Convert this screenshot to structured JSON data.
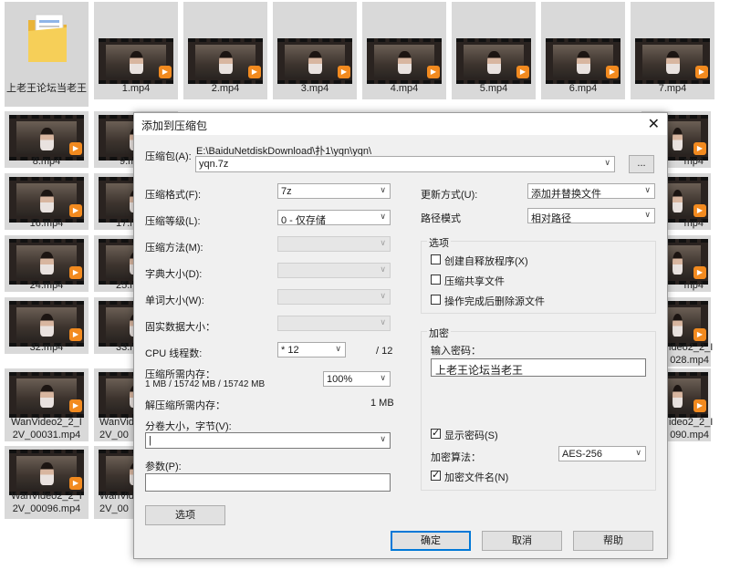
{
  "explorer": {
    "folder_name": "上老王论坛当老王",
    "tiles": [
      {
        "name": "1.mp4"
      },
      {
        "name": "2.mp4"
      },
      {
        "name": "3.mp4"
      },
      {
        "name": "4.mp4"
      },
      {
        "name": "5.mp4"
      },
      {
        "name": "6.mp4"
      },
      {
        "name": "7.mp4"
      },
      {
        "name": "8.mp4"
      },
      {
        "name": "9.m"
      },
      {
        "name": "mp4"
      },
      {
        "name": "16.mp4"
      },
      {
        "name": "17.m"
      },
      {
        "name": "mp4"
      },
      {
        "name": "24.mp4"
      },
      {
        "name": "25.m"
      },
      {
        "name": "mp4"
      },
      {
        "name": "32.mp4"
      },
      {
        "name": "33.m"
      },
      {
        "name": "ideo2_2_I 028.mp4"
      },
      {
        "name": "WanVideo2_2_I 2V_00031.mp4"
      },
      {
        "name": "WanVid 2V_00"
      },
      {
        "name": "ideo2_2_I 090.mp4"
      },
      {
        "name": "WanVideo2_2_I 2V_00096.mp4"
      },
      {
        "name": "WanVid 2V_00"
      }
    ]
  },
  "dialog": {
    "title": "添加到压缩包",
    "archive_label": "压缩包(A):",
    "archive_path": "E:\\BaiduNetdiskDownload\\扑1\\yqn\\yqn\\",
    "archive_name": "yqn.7z",
    "browse_label": "...",
    "format_label": "压缩格式(F):",
    "format_value": "7z",
    "level_label": "压缩等级(L):",
    "level_value": "0 - 仅存储",
    "method_label": "压缩方法(M):",
    "dict_label": "字典大小(D):",
    "word_label": "单词大小(W):",
    "solid_label": "固实数据大小：",
    "cpu_label": "CPU 线程数:",
    "cpu_value": "* 12",
    "cpu_total": "/ 12",
    "mem_label": "压缩所需内存：",
    "mem_value": "1 MB / 15742 MB / 15742 MB",
    "mem_percent": "100%",
    "decomp_label": "解压缩所需内存：",
    "decomp_value": "1 MB",
    "split_label": "分卷大小，字节(V):",
    "split_value": "|",
    "params_label": "参数(P):",
    "options_button": "选项",
    "update_label": "更新方式(U):",
    "update_value": "添加并替换文件",
    "path_label": "路径模式",
    "path_value": "相对路径",
    "options_group": "选项",
    "opt_sfx": "创建自释放程序(X)",
    "opt_shared": "压缩共享文件",
    "opt_delete": "操作完成后删除源文件",
    "encrypt_group": "加密",
    "password_label": "输入密码：",
    "password_value": "上老王论坛当老王",
    "show_password": "显示密码(S)",
    "enc_method_label": "加密算法：",
    "enc_method_value": "AES-256",
    "enc_names": "加密文件名(N)",
    "ok": "确定",
    "cancel": "取消",
    "help": "帮助",
    "close_icon": "close-icon"
  }
}
